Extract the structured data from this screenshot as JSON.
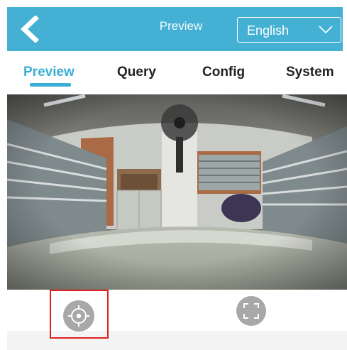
{
  "header": {
    "title": "Preview",
    "back_icon": "chevron-left-icon",
    "language": {
      "selected": "English",
      "icon": "chevron-down-icon"
    },
    "background_color": "#44b1d4"
  },
  "tabs": [
    {
      "label": "Preview",
      "active": true
    },
    {
      "label": "Query",
      "active": false
    },
    {
      "label": "Config",
      "active": false
    },
    {
      "label": "System",
      "active": false
    }
  ],
  "accent_color": "#3aaed6",
  "video": {
    "description_icon": "live-camera-feed",
    "view": "fisheye"
  },
  "controls": {
    "ptz_icon": "target-crosshair-icon",
    "fullscreen_icon": "fullscreen-icon",
    "highlight_color": "#e02020"
  }
}
